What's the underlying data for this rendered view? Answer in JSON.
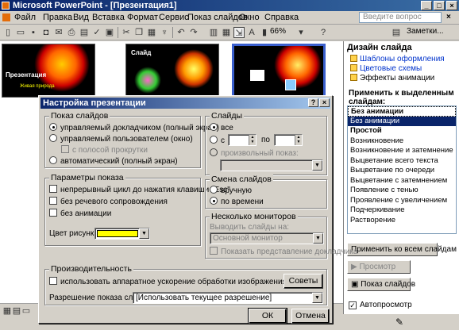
{
  "window": {
    "title": "Microsoft PowerPoint - [Презентация1]"
  },
  "menu": {
    "items": [
      "Файл",
      "Правка",
      "Вид",
      "Вставка",
      "Формат",
      "Сервис",
      "Показ слайдов",
      "Окно",
      "Справка"
    ],
    "ask_placeholder": "Введите вопрос",
    "close_glyph": "×"
  },
  "toolbar": {
    "zoom": "66%",
    "notes_label": "Заметки..."
  },
  "slides": [
    {
      "title": "Презентация",
      "subtitle": "Живая природа"
    },
    {
      "title": "Слайд",
      "subtitle": ""
    },
    {
      "title": "",
      "subtitle": ""
    }
  ],
  "taskpane": {
    "title": "Дизайн слайда",
    "links": [
      "Шаблоны оформления",
      "Цветовые схемы",
      "Эффекты анимации"
    ],
    "apply_label": "Применить к выделенным слайдам:",
    "effects": [
      "Без анимации",
      "Без анимации",
      "Простой",
      "Возникновение",
      "Возникновение и затемнение",
      "Выцветание всего текста",
      "Выцветание по очереди",
      "Выцветание с затемнением",
      "Появление с тенью",
      "Проявление с увеличением",
      "Подчеркивание",
      "Растворение"
    ],
    "selected_effect_index": 1,
    "apply_all_button": "Применить ко всем слайдам",
    "preview_button": "Просмотр",
    "show_button": "Показ слайдов",
    "autopreview_label": "Автопросмотр"
  },
  "dialog": {
    "title": "Настройка презентации",
    "help_glyph": "?",
    "close_glyph": "×",
    "show_group": {
      "title": "Показ слайдов",
      "options": [
        "управляемый докладчиком (полный экран)",
        "управляемый пользователем (окно)",
        "с полосой прокрутки",
        "автоматический (полный экран)"
      ]
    },
    "slides_group": {
      "title": "Слайды",
      "all": "все",
      "from": "с",
      "to": "по",
      "custom": "произвольный показ:"
    },
    "params_group": {
      "title": "Параметры показа",
      "options": [
        "непрерывный цикл до нажатия клавиши \"Esc\"",
        "без речевого сопровождения",
        "без анимации"
      ],
      "pen_color_label": "Цвет рисунка:",
      "pen_color": "#ffff00"
    },
    "change_group": {
      "title": "Смена слайдов",
      "options": [
        "вручную",
        "по времени"
      ]
    },
    "monitors_group": {
      "title": "Несколько мониторов",
      "display_on_label": "Выводить слайды на:",
      "monitor_value": "Основной монитор",
      "presenter_view": "Показать представление докладчика"
    },
    "performance_group": {
      "title": "Производительность",
      "accel_label": "использовать аппаратное ускорение обработки изображения",
      "tips_button": "Советы",
      "resolution_label": "Разрешение показа слайдов:",
      "resolution_value": "[Использовать текущее разрешение]"
    },
    "ok": "ОК",
    "cancel": "Отмена"
  }
}
